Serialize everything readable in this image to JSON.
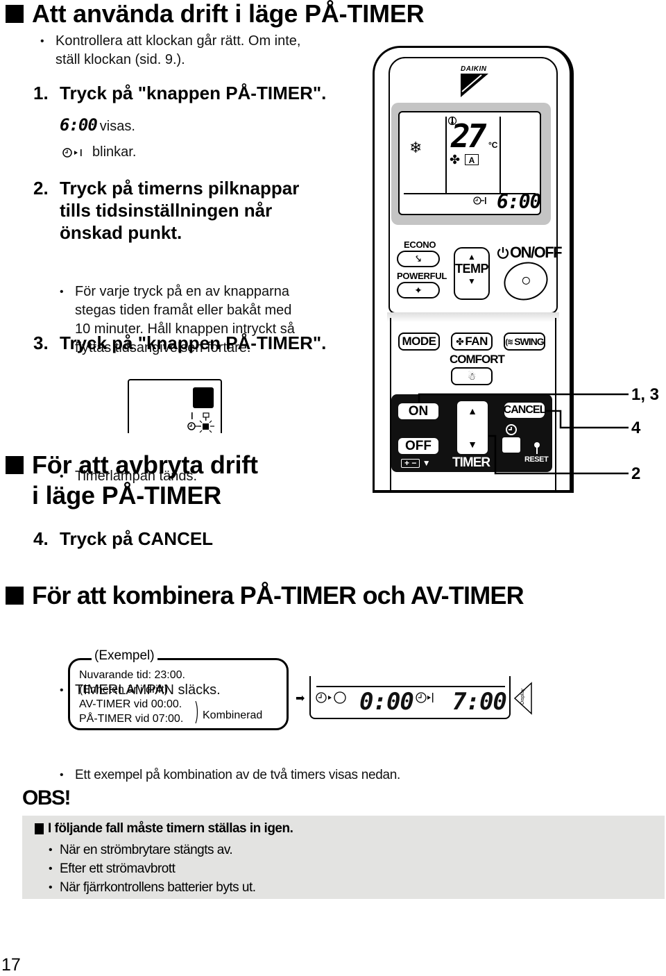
{
  "section1": {
    "title": "Att använda drift i läge PÅ-TIMER",
    "intro_bullet_line1": "Kontrollera att klockan går rätt. Om inte,",
    "intro_bullet_line2": "ställ klockan (sid. 9.).",
    "steps": [
      {
        "number": "1.",
        "title": "Tryck på \"knappen PÅ-TIMER\".",
        "display_value": "6:00",
        "display_suffix": "visas.",
        "icon_suffix": "blinkar."
      },
      {
        "number": "2.",
        "title_lines": [
          "Tryck på timerns pilknappar",
          "tills tidsinställningen når",
          "önskad punkt."
        ],
        "bullet_lines": [
          "För varje tryck på en av knapparna",
          "stegas tiden framåt eller bakåt med",
          "10 minuter. Håll knappen intryckt så",
          "flyttas tidsangivelsen fortare."
        ]
      },
      {
        "number": "3.",
        "title": "Tryck på \"knappen PÅ-TIMER\".",
        "bullet": "Timerlampan tänds."
      }
    ]
  },
  "section2": {
    "title_line1": "För att avbryta drift",
    "title_line2": "i läge PÅ-TIMER",
    "step": {
      "number": "4.",
      "title": "Tryck på CANCEL",
      "bullet": "TIMERLAMPAN släcks."
    }
  },
  "section3": {
    "title": "För att kombinera PÅ-TIMER och AV-TIMER",
    "bullet": "Ett exempel på kombination av de två timers visas nedan.",
    "example": {
      "heading": "(Exempel)",
      "lines": [
        "Nuvarande tid: 23:00.",
        "(Enheten är i drift)",
        "AV-TIMER vid 00:00.",
        "PÅ-TIMER vid 07:00."
      ],
      "combined_label": "Kombinerad"
    },
    "display": {
      "off_time": "0:00",
      "on_time": "7:00",
      "tab_label": "Display"
    }
  },
  "remote": {
    "brand": "DAIKIN",
    "lcd": {
      "temperature": "27",
      "unit": "°C",
      "fan_mode": "A",
      "timer_time": "6:00"
    },
    "buttons": {
      "econo": "ECONO",
      "powerful": "POWERFUL",
      "temp": "TEMP",
      "on_off": "ON/OFF",
      "mode": "MODE",
      "fan": "FAN",
      "swing": "SWING",
      "comfort": "COMFORT",
      "on": "ON",
      "off": "OFF",
      "cancel": "CANCEL",
      "timer": "TIMER",
      "reset": "RESET"
    },
    "callouts": [
      "1, 3",
      "4",
      "2"
    ]
  },
  "obs": {
    "title": "OBS!",
    "heading": "I följande fall måste timern ställas in igen.",
    "bullets": [
      "När en strömbrytare stängts av.",
      "Efter ett strömavbrott",
      "När fjärrkontrollens batterier byts ut."
    ]
  },
  "page_number": "17"
}
